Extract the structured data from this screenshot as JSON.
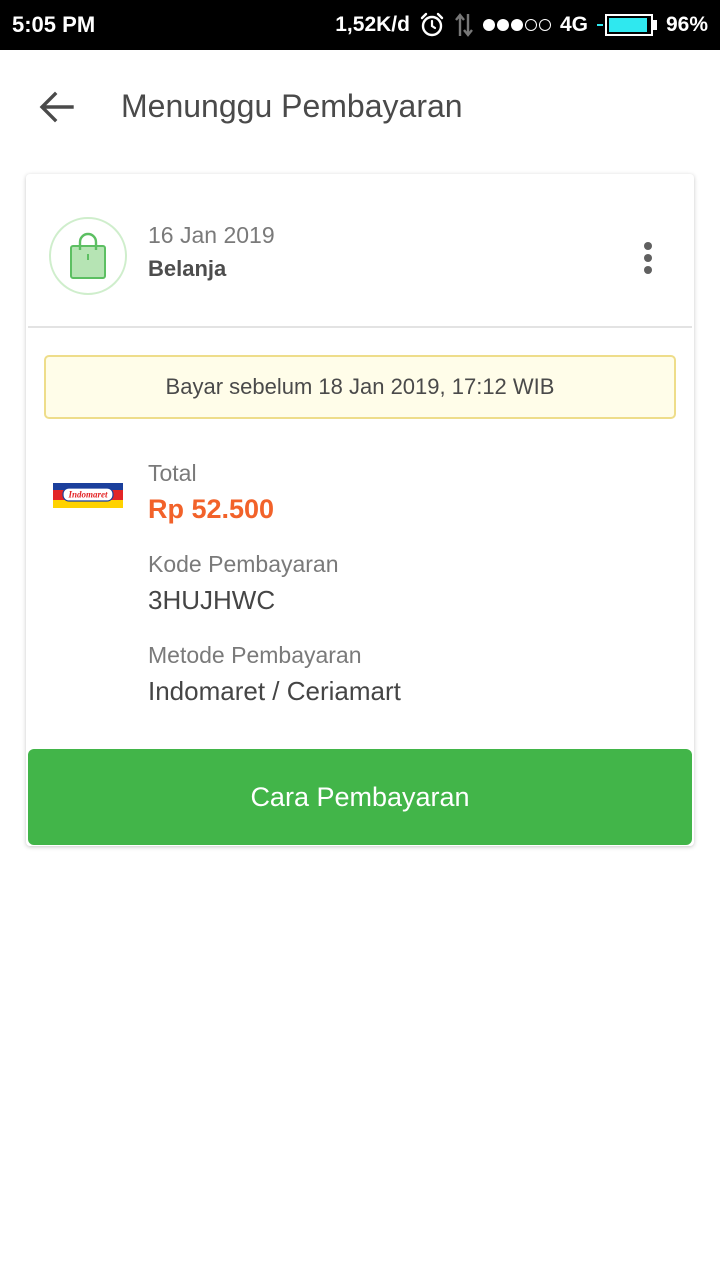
{
  "status_bar": {
    "time": "5:05 PM",
    "network_speed": "1,52K/d",
    "network_type": "4G",
    "battery_percent": "96%",
    "battery_level": 0.96,
    "signal_bars_filled": 3,
    "signal_bars_total": 5,
    "icons": [
      "alarm-icon",
      "data-transfer-icon",
      "signal-icon",
      "battery-icon"
    ]
  },
  "header": {
    "title": "Menunggu Pembayaran",
    "back_icon": "arrow-left-icon"
  },
  "order": {
    "icon": "shopping-bag-icon",
    "date": "16 Jan 2019",
    "type": "Belanja",
    "menu_icon": "more-vertical-icon",
    "deadline": "Bayar sebelum 18 Jan 2019, 17:12 WIB",
    "merchant_logo_text": "Indomaret",
    "total_label": "Total",
    "total_value": "Rp 52.500",
    "code_label": "Kode Pembayaran",
    "code_value": "3HUJHWC",
    "method_label": "Metode Pembayaran",
    "method_value": "Indomaret / Ceriamart",
    "button_label": "Cara Pembayaran"
  },
  "colors": {
    "primary_green": "#42b549",
    "total_orange": "#f2622a",
    "deadline_bg": "#fffde9",
    "deadline_border": "#eedd8a",
    "battery_fill": "#2fe8ef"
  }
}
